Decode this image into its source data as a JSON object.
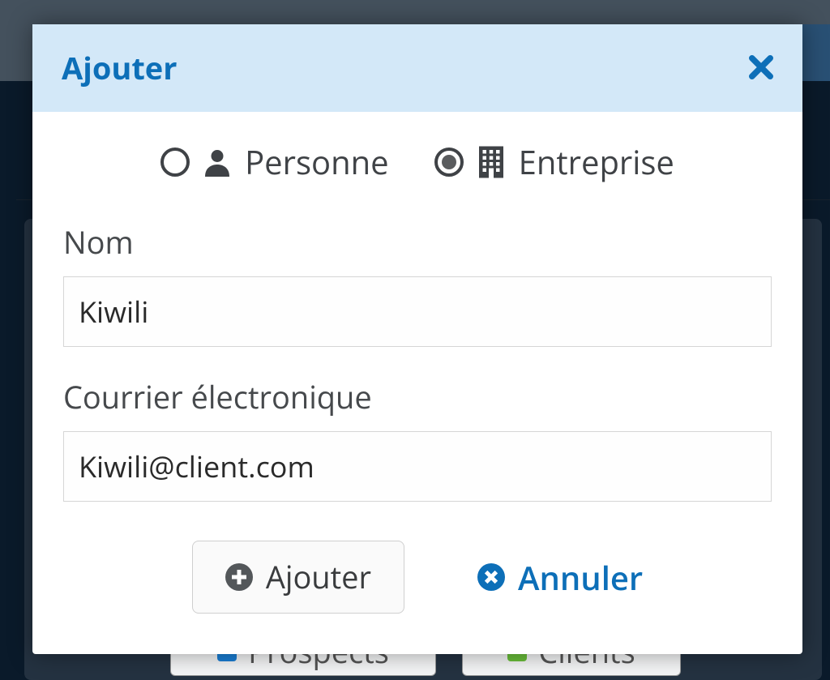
{
  "modal": {
    "title": "Ajouter",
    "type_options": {
      "person": {
        "label": "Personne",
        "selected": false
      },
      "company": {
        "label": "Entreprise",
        "selected": true
      }
    },
    "fields": {
      "name": {
        "label": "Nom",
        "value": "Kiwili"
      },
      "email": {
        "label": "Courrier électronique",
        "value": "Kiwili@client.com"
      }
    },
    "actions": {
      "add_label": "Ajouter",
      "cancel_label": "Annuler"
    }
  },
  "background": {
    "prospects_label": "Prospects",
    "clients_label": "Clients"
  }
}
